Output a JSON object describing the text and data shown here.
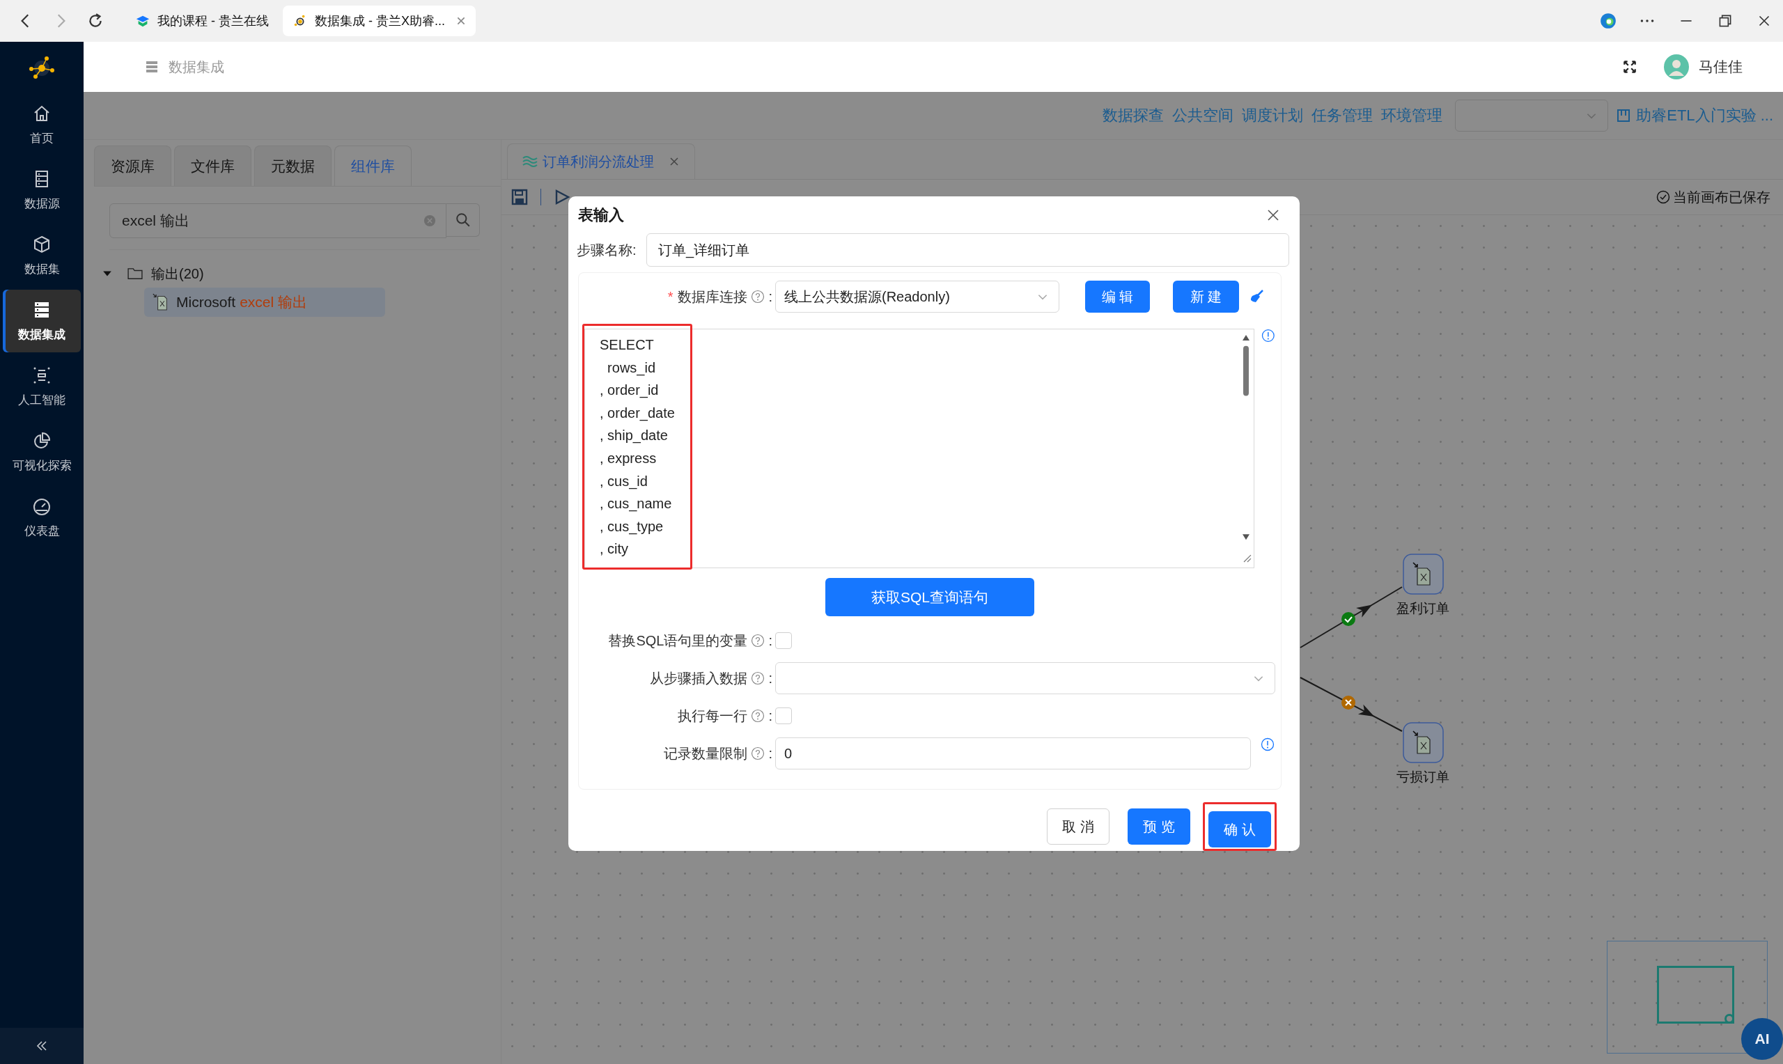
{
  "browser": {
    "tabs": [
      {
        "title": "我的课程 - 贵兰在线",
        "selected": false
      },
      {
        "title": "数据集成 - 贵兰X助睿...",
        "selected": true
      }
    ]
  },
  "sidebar": {
    "items": [
      {
        "label": "首页",
        "kind": "home",
        "selected": false
      },
      {
        "label": "数据源",
        "kind": "source",
        "selected": false
      },
      {
        "label": "数据集",
        "kind": "dataset",
        "selected": false
      },
      {
        "label": "数据集成",
        "kind": "integration",
        "selected": true
      },
      {
        "label": "人工智能",
        "kind": "ai",
        "selected": false
      },
      {
        "label": "可视化探索",
        "kind": "chart",
        "selected": false
      },
      {
        "label": "仪表盘",
        "kind": "dashboard",
        "selected": false
      }
    ]
  },
  "header": {
    "title": "数据集成",
    "user": "马佳佳"
  },
  "top_nav": {
    "links": [
      "数据探查",
      "公共空间",
      "调度计划",
      "任务管理",
      "环境管理"
    ],
    "project": "助睿ETL入门实验 ..."
  },
  "left_panel": {
    "tabs": [
      {
        "label": "资源库",
        "selected": false
      },
      {
        "label": "文件库",
        "selected": false
      },
      {
        "label": "元数据",
        "selected": false
      },
      {
        "label": "组件库",
        "selected": true
      }
    ],
    "search": {
      "value": "excel 输出"
    },
    "tree": [
      {
        "label": "输出(20)",
        "expanded": true,
        "children": [
          {
            "label": "Microsoft",
            "match": "excel 输出",
            "selected": true
          }
        ]
      }
    ]
  },
  "canvas": {
    "tab": {
      "title": "订单利润分流处理"
    },
    "save_status": "当前画布已保存",
    "nodes": [
      {
        "label": "盈利订单"
      },
      {
        "label": "亏损订单"
      }
    ],
    "hops": [
      {
        "kind": "success"
      },
      {
        "kind": "failure"
      }
    ],
    "ai_button": "AI"
  },
  "dialog": {
    "title": "表输入",
    "step_name": {
      "label": "步骤名称:",
      "value": "订单_详细订单"
    },
    "connection": {
      "required_mark": "*",
      "label": "数据库连接",
      "colon": ":",
      "value": "线上公共数据源(Readonly)",
      "buttons": [
        "编 辑",
        "新 建"
      ]
    },
    "sql": {
      "highlighted": true,
      "lines": [
        "SELECT",
        "  rows_id",
        ", order_id",
        ", order_date",
        ", ship_date",
        ", express",
        ", cus_id",
        ", cus_name",
        ", cus_type",
        ", city"
      ]
    },
    "get_sql_button": "获取SQL查询语句",
    "options": [
      {
        "kind": "checkbox",
        "label": "替换SQL语句里的变量",
        "colon": ":",
        "checked": false
      },
      {
        "kind": "select",
        "label": "从步骤插入数据",
        "colon": ":"
      },
      {
        "kind": "checkbox",
        "label": "执行每一行",
        "colon": ":",
        "checked": false
      },
      {
        "kind": "input",
        "label": "记录数量限制",
        "colon": ":",
        "value": "0"
      }
    ],
    "buttons": [
      {
        "label": "取 消",
        "kind": "default",
        "highlighted": false
      },
      {
        "label": "预 览",
        "kind": "primary",
        "highlighted": false
      },
      {
        "label": "确 认",
        "kind": "primary",
        "highlighted": true
      }
    ]
  }
}
